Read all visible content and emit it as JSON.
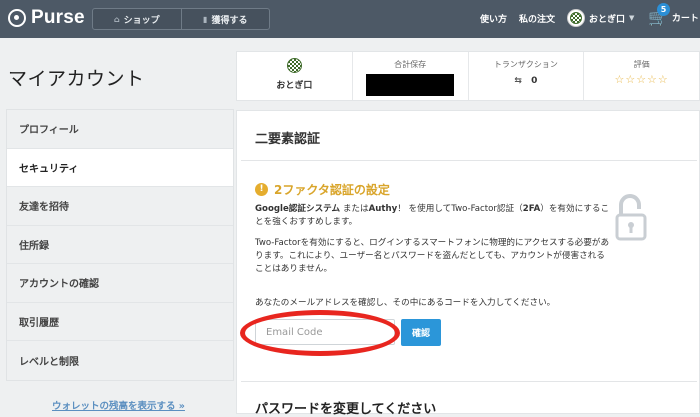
{
  "header": {
    "logo_text": "Purse",
    "nav": [
      {
        "icon": "shop-icon",
        "label": "ショップ"
      },
      {
        "icon": "earn-icon",
        "label": "獲得する"
      }
    ],
    "how_to_use": "使い方",
    "my_orders": "私の注文",
    "username": "おとぎ口",
    "cart_label": "カート",
    "cart_count": "5"
  },
  "page_title": "マイアカウント",
  "sidebar": {
    "items": [
      {
        "label": "プロフィール",
        "active": false
      },
      {
        "label": "セキュリティ",
        "active": true
      },
      {
        "label": "友達を招待",
        "active": false
      },
      {
        "label": "住所録",
        "active": false
      },
      {
        "label": "アカウントの確認",
        "active": false
      },
      {
        "label": "取引履歴",
        "active": false
      },
      {
        "label": "レベルと制限",
        "active": false
      }
    ],
    "wallet_link": "ウォレットの残高を表示する »"
  },
  "stats": {
    "username": "おとぎ口",
    "savings_label": "合計保存",
    "transactions_label": "トランザクション",
    "transactions_value": "0",
    "rating_label": "評価",
    "rating_stars": "☆☆☆☆☆"
  },
  "security": {
    "section_title": "二要素認証",
    "warning_title": "2ファクタ認証の設定",
    "intro_bold_1": "Google認証システム",
    "intro_mid": " または",
    "intro_bold_2": "Authy",
    "intro_rest": "！ を使用してTwo-Factor認証（",
    "intro_bold_3": "2FA",
    "intro_end": "）を有効にすることを強くおすすめします。",
    "paragraph_2": "Two-Factorを有効にすると、ログインするスマートフォンに物理的にアクセスする必要があります。これにより、ユーザー名とパスワードを盗んだとしても、アカウントが侵害されることはありません。",
    "email_instruction": "あなたのメールアドレスを確認し、その中にあるコードを入力してください。",
    "email_placeholder": "Email Code",
    "confirm_button": "確認",
    "password_title": "パスワードを変更してください"
  },
  "colors": {
    "header_bg": "#4d5966",
    "accent": "#2b96d9",
    "warning": "#d9a52b",
    "highlight_circle": "#e8261f"
  }
}
